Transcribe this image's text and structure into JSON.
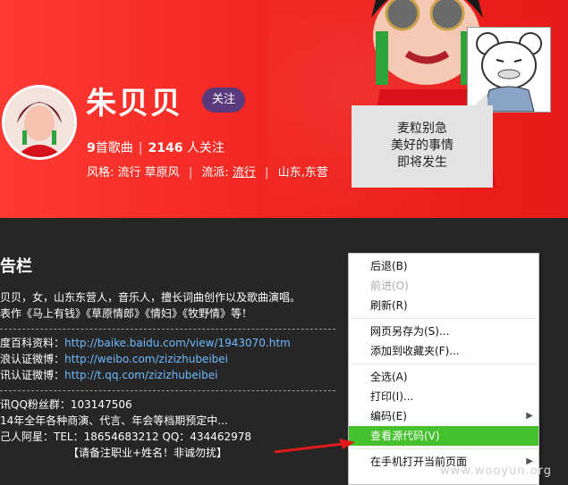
{
  "header": {
    "artist_name": "朱贝贝",
    "follow_label": "关注",
    "song_count": "9",
    "song_count_suffix": "首歌曲",
    "followers": "2146",
    "followers_suffix": "人关注",
    "style_label": "风格:",
    "style_values": "流行 草原风",
    "genre_label": "流派:",
    "genre_value": "流行",
    "location": "山东,东营"
  },
  "meme": {
    "caption_lines": [
      "麦粒别急",
      "美好的事情",
      "即将发生"
    ]
  },
  "board": {
    "title": "告栏",
    "bio_line1": "贝贝，女，山东东营人，音乐人，擅长词曲创作以及歌曲演唱。",
    "bio_line2": "表作《马上有钱》《草原情郎》《情妇》《牧野情》等！",
    "baike_label": "度百科资料：",
    "baike_url": "http://baike.baidu.com/view/1943070.htm",
    "weibo_label": "浪认证微博：",
    "weibo_url": "http://weibo.com/zizizhubeibei",
    "tqq_label": "讯认证微博：",
    "tqq_url": "http://t.qq.com/zizizhubeibei",
    "qq_group": "讯QQ粉丝群：103147506",
    "booking": "14年全年各种商演、代言、年会等档期预定中...",
    "contact": "己人阿星：TEL：18654683212      QQ：434462978",
    "note": "【请备注职业+姓名！非诚勿扰】"
  },
  "context_menu": {
    "items": [
      {
        "label": "后退(B)",
        "disabled": false
      },
      {
        "label": "前进(O)",
        "disabled": true
      },
      {
        "label": "刷新(R)",
        "disabled": false
      },
      {
        "label": "网页另存为(S)...",
        "disabled": false
      },
      {
        "label": "添加到收藏夹(F)...",
        "disabled": false
      },
      {
        "label": "全选(A)",
        "disabled": false
      },
      {
        "label": "打印(I)...",
        "disabled": false
      },
      {
        "label": "编码(E)",
        "disabled": false
      },
      {
        "label": "查看源代码(V)",
        "disabled": false
      },
      {
        "label": "在手机打开当前页面",
        "disabled": false
      }
    ]
  },
  "watermark": "www.wooyun.org",
  "colors": {
    "banner_red": "#f0231e",
    "menu_highlight": "#44c12d",
    "follow_button": "#5a3a7c",
    "link_blue": "#6fbbff"
  }
}
